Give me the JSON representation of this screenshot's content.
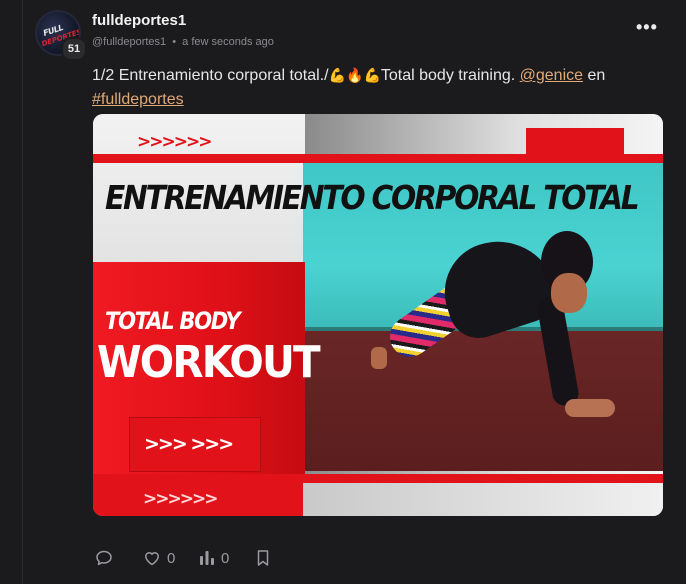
{
  "post": {
    "author": {
      "name": "fulldeportes1",
      "handle": "@fulldeportes1",
      "badge_count": "51",
      "avatar_text_1": "FULL",
      "avatar_text_2": "DEPORTES"
    },
    "separator": "•",
    "timestamp": "a few seconds ago",
    "more_label": "•••",
    "text": {
      "prefix": "1/2 Entrenamiento corporal total./",
      "emoji_1": "💪",
      "emoji_2": "🔥",
      "emoji_3": "💪",
      "middle": "Total body training. ",
      "mention": "@genice",
      "after_mention": " en",
      "hashtag": "#fulldeportes"
    },
    "media": {
      "headline": "ENTRENAMIENTO CORPORAL  TOTAL",
      "subheading_1": "TOTAL BODY",
      "subheading_2": "WORKOUT",
      "arrows_top": ">>>>>>",
      "arrows_button": ">>> >>>",
      "arrows_bottom": ">>>>>>"
    },
    "actions": {
      "reply_icon": "comment-icon",
      "like_count": "0",
      "views_count": "0",
      "bookmark_icon": "bookmark-icon"
    }
  }
}
